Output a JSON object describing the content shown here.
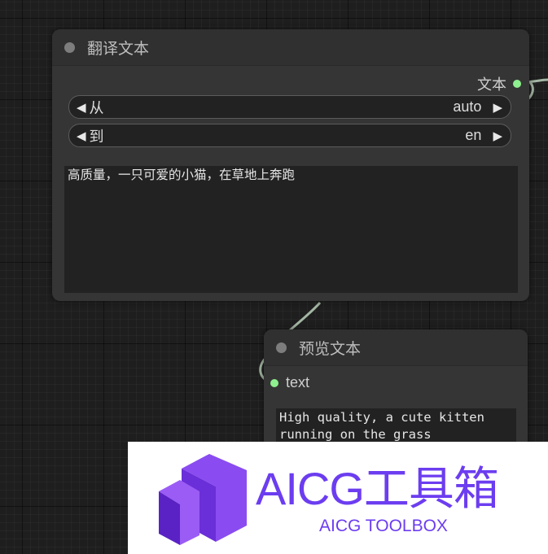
{
  "translate_node": {
    "title": "翻译文本",
    "output_label": "文本",
    "from_combo": {
      "label": "从",
      "value": "auto"
    },
    "to_combo": {
      "label": "到",
      "value": "en"
    },
    "text_value": "高质量，一只可爱的小猫，在草地上奔跑"
  },
  "preview_node": {
    "title": "预览文本",
    "input_label": "text",
    "text_value": "High quality, a cute kitten\nrunning on the grass"
  },
  "banner": {
    "title": "AICG工具箱",
    "subtitle": "AICG TOOLBOX",
    "brand_color": "#6c3df0"
  },
  "colors": {
    "slot": "#8ff08f",
    "link": "#a4b6a4",
    "canvas": "#1e1e1e"
  }
}
